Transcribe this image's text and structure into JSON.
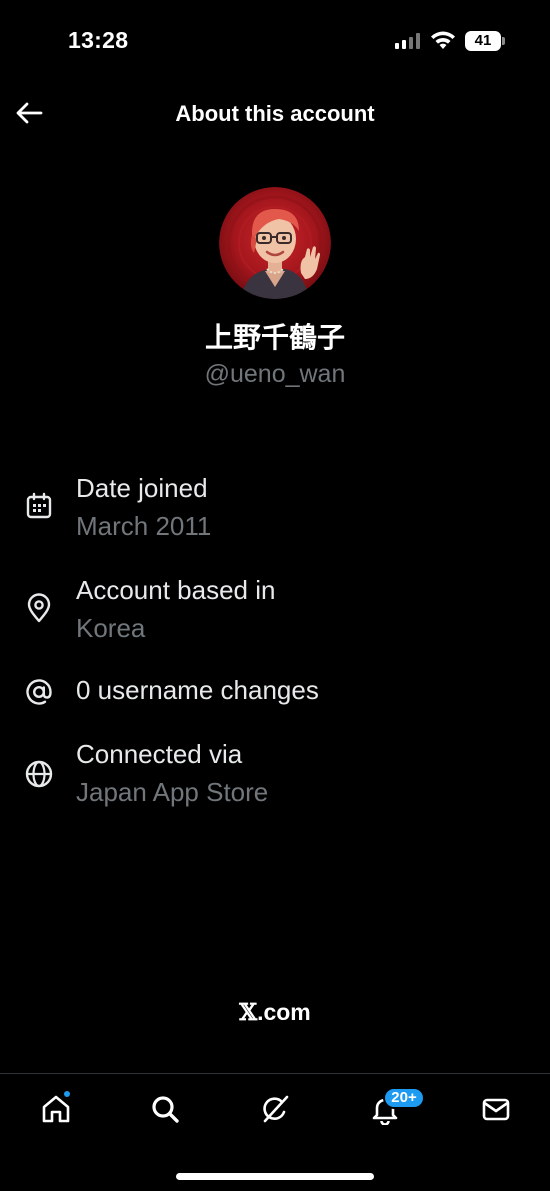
{
  "status_bar": {
    "time": "13:28",
    "battery": "41"
  },
  "header": {
    "title": "About this account",
    "back_icon": "arrow-left-icon"
  },
  "profile": {
    "display_name": "上野千鶴子",
    "handle": "@ueno_wan"
  },
  "info": [
    {
      "icon": "calendar-icon",
      "title": "Date joined",
      "value": "March 2011"
    },
    {
      "icon": "location-pin-icon",
      "title": "Account based in",
      "value": "Korea"
    },
    {
      "icon": "at-sign-icon",
      "title": "0 username changes"
    },
    {
      "icon": "globe-icon",
      "title": "Connected via",
      "value": "Japan App Store"
    }
  ],
  "footer": {
    "brand_mark": "𝕏",
    "domain": ".com"
  },
  "nav": {
    "items": [
      "home-icon",
      "search-icon",
      "grok-icon",
      "notifications-icon",
      "messages-icon"
    ],
    "notifications_badge": "20+"
  },
  "colors": {
    "background": "#000000",
    "text_primary": "#e7e9ea",
    "text_secondary": "#71767b",
    "accent": "#1d9bf0"
  }
}
